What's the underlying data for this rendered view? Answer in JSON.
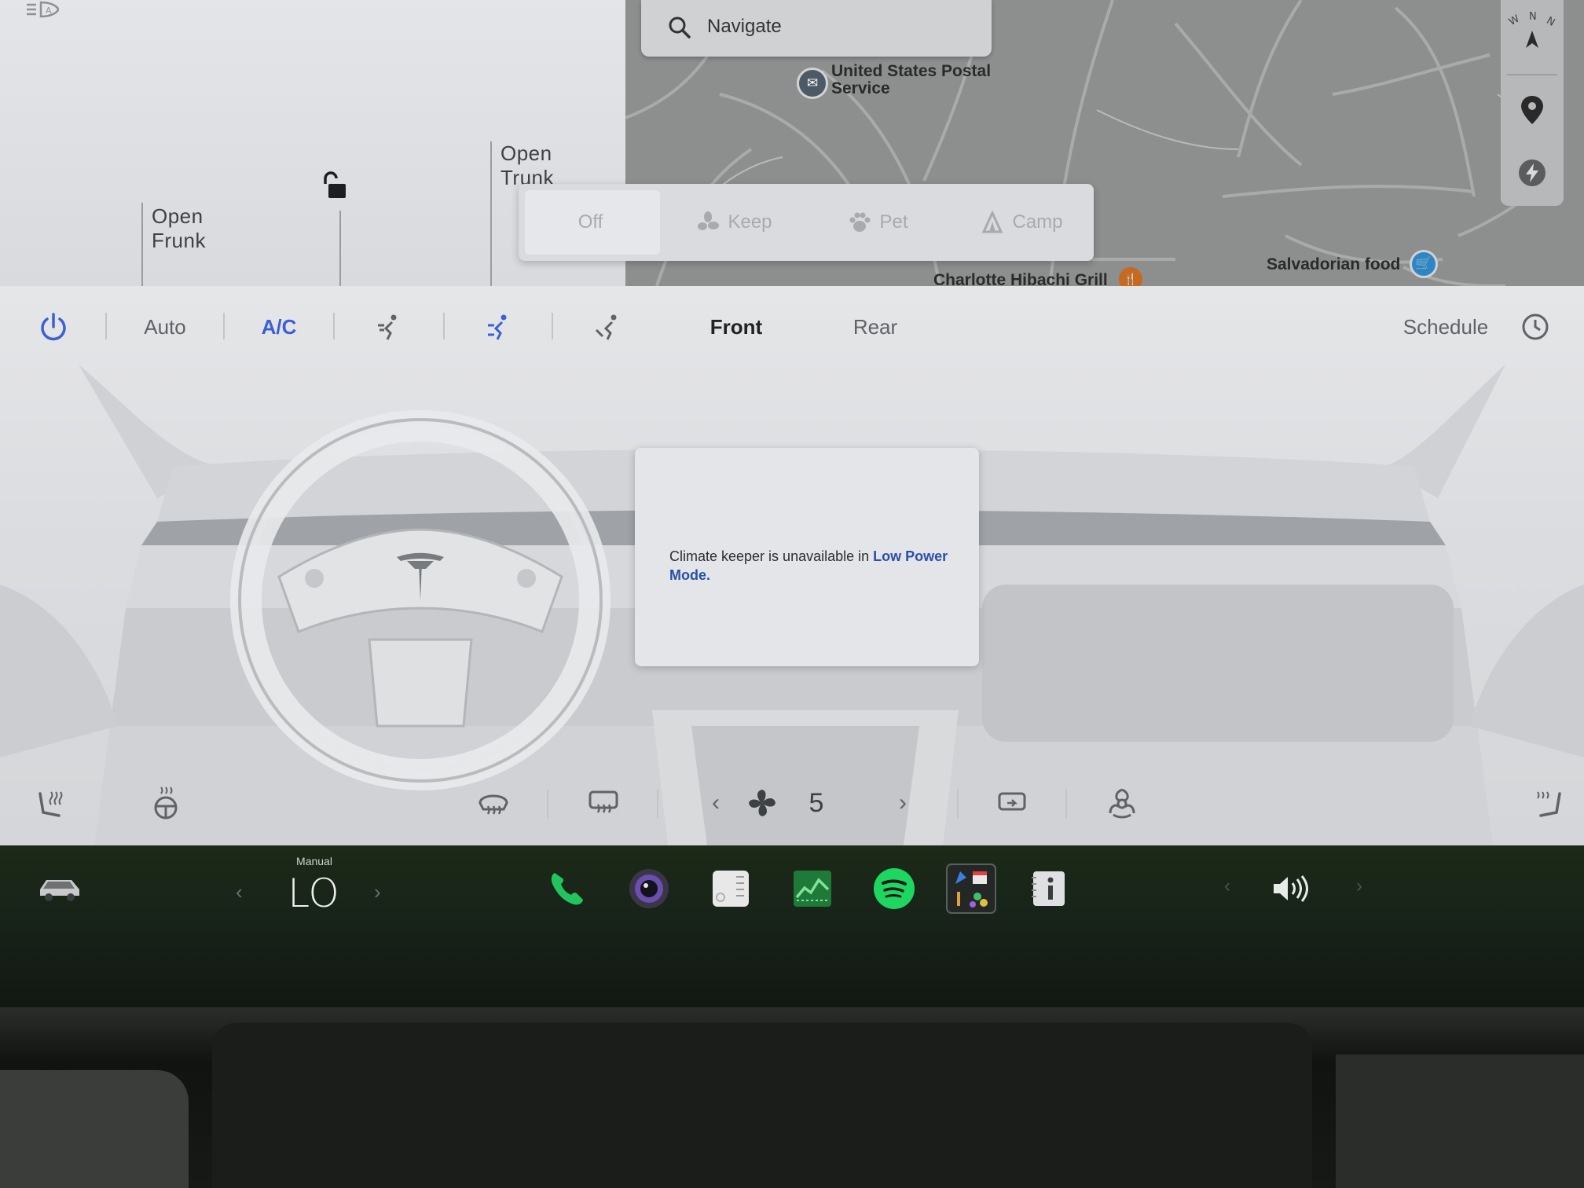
{
  "car": {
    "frunk_label": "Open\nFrunk",
    "trunk_label": "Open\nTrunk",
    "lock_state": "unlocked-lock-icon"
  },
  "map": {
    "search_placeholder": "Navigate",
    "compass": "W N N",
    "pois": [
      {
        "name": "United States Postal\nService",
        "icon": "mail-icon",
        "color": "#4d5a66"
      },
      {
        "name": "Charlotte Hibachi Grill",
        "icon": "restaurant-icon",
        "color": "#c66a1f"
      },
      {
        "name": "Salvadorian food",
        "icon": "shopping-cart-icon",
        "color": "#2f86c6"
      }
    ]
  },
  "modes": {
    "items": [
      {
        "label": "Off",
        "icon": ""
      },
      {
        "label": "Keep",
        "icon": "fan-icon"
      },
      {
        "label": "Pet",
        "icon": "paw-icon"
      },
      {
        "label": "Camp",
        "icon": "tent-icon"
      }
    ],
    "selected": "Off"
  },
  "climate": {
    "auto_label": "Auto",
    "ac_label": "A/C",
    "front_label": "Front",
    "rear_label": "Rear",
    "schedule_label": "Schedule",
    "fan_speed": "5",
    "message_text": "Climate keeper is unavailable in ",
    "message_link": "Low Power Mode.",
    "accent": "#3b5fd4"
  },
  "dock": {
    "temp_mode": "Manual",
    "temperature": "LO",
    "apps": [
      "phone-icon",
      "camera-icon",
      "calendar-icon",
      "energy-icon",
      "spotify-icon",
      "toybox-icon",
      "manual-icon"
    ],
    "phone_color": "#22c45e",
    "spotify_color": "#1ed760"
  }
}
